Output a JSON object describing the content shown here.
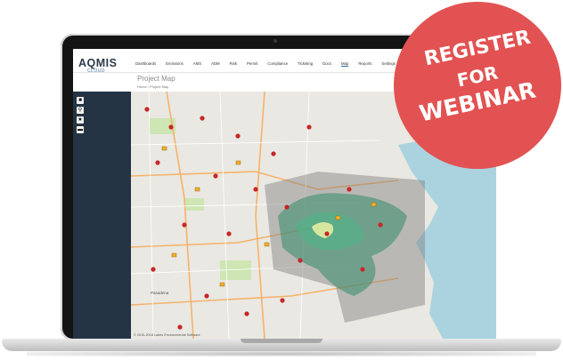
{
  "app": {
    "logo": "AQMIS",
    "logo_sub": "CLOUD",
    "nav": [
      "Dashboards",
      "Emissions",
      "AMS",
      "ADM",
      "Risk",
      "Permit",
      "Compliance",
      "Ticketing",
      "Docs",
      "Map",
      "Reports",
      "Settings"
    ],
    "active_nav": "Map",
    "page_title": "Project Map",
    "breadcrumb": "Home / Project Map",
    "copyright": "© 2015-2018 Lakes Environmental Software"
  },
  "map": {
    "map_labels": [
      "Pasadena"
    ],
    "sidebar_tools": [
      "layers-icon",
      "search-icon",
      "star-icon",
      "folder-icon"
    ]
  },
  "promo": {
    "line1": "REGISTER",
    "line2": "FOR",
    "line3": "WEBINAR",
    "color": "#e25252"
  }
}
